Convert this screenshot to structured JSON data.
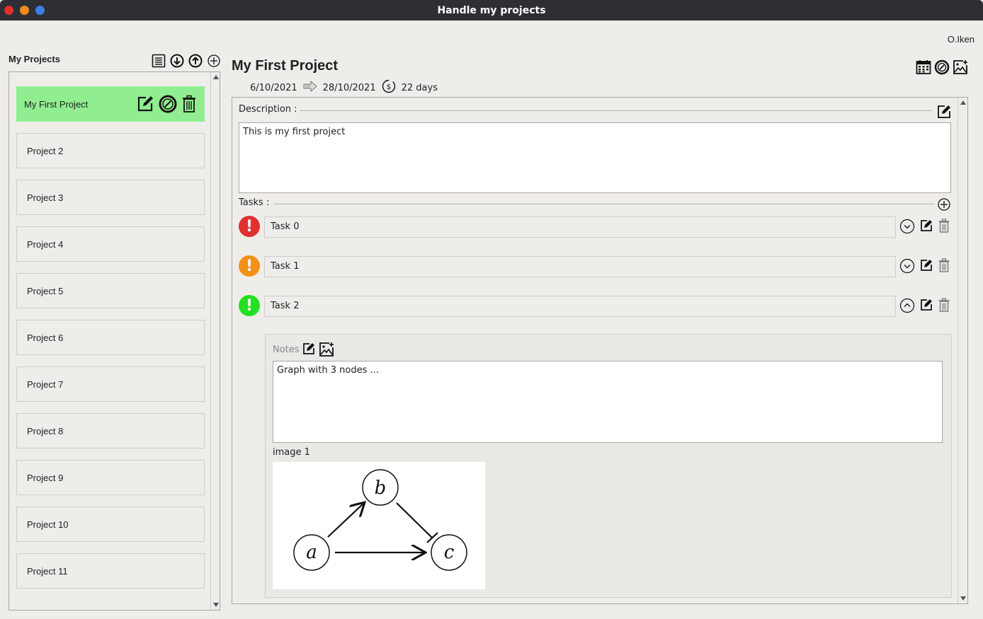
{
  "window": {
    "title": "Handle my projects"
  },
  "user": {
    "name": "O.Iken"
  },
  "sidebar": {
    "title": "My Projects",
    "tools": [
      "list-icon",
      "download-icon",
      "upload-icon",
      "add-icon"
    ],
    "projects": [
      {
        "label": "My First Project",
        "active": true
      },
      {
        "label": "Project 2"
      },
      {
        "label": "Project 3"
      },
      {
        "label": "Project 4"
      },
      {
        "label": "Project 5"
      },
      {
        "label": "Project 6"
      },
      {
        "label": "Project 7"
      },
      {
        "label": "Project 8"
      },
      {
        "label": "Project 9"
      },
      {
        "label": "Project 10"
      },
      {
        "label": "Project 11"
      }
    ]
  },
  "project": {
    "title": "My First Project",
    "start_date": "6/10/2021",
    "end_date": "28/10/2021",
    "duration": "22 days",
    "description_label": "Description :",
    "description": "This is my first project",
    "tasks_label": "Tasks :",
    "tasks": [
      {
        "name": "Task 0",
        "priority_color": "#e03030",
        "expanded": false
      },
      {
        "name": "Task 1",
        "priority_color": "#f39018",
        "expanded": false
      },
      {
        "name": "Task 2",
        "priority_color": "#22e022",
        "expanded": true
      }
    ],
    "notes": {
      "label": "Notes",
      "text": "Graph with 3 nodes ...",
      "image_label": "image 1",
      "graph_nodes": [
        "a",
        "b",
        "c"
      ]
    }
  },
  "colors": {
    "active_project": "#90ee90",
    "titlebar": "#2d2f35"
  }
}
